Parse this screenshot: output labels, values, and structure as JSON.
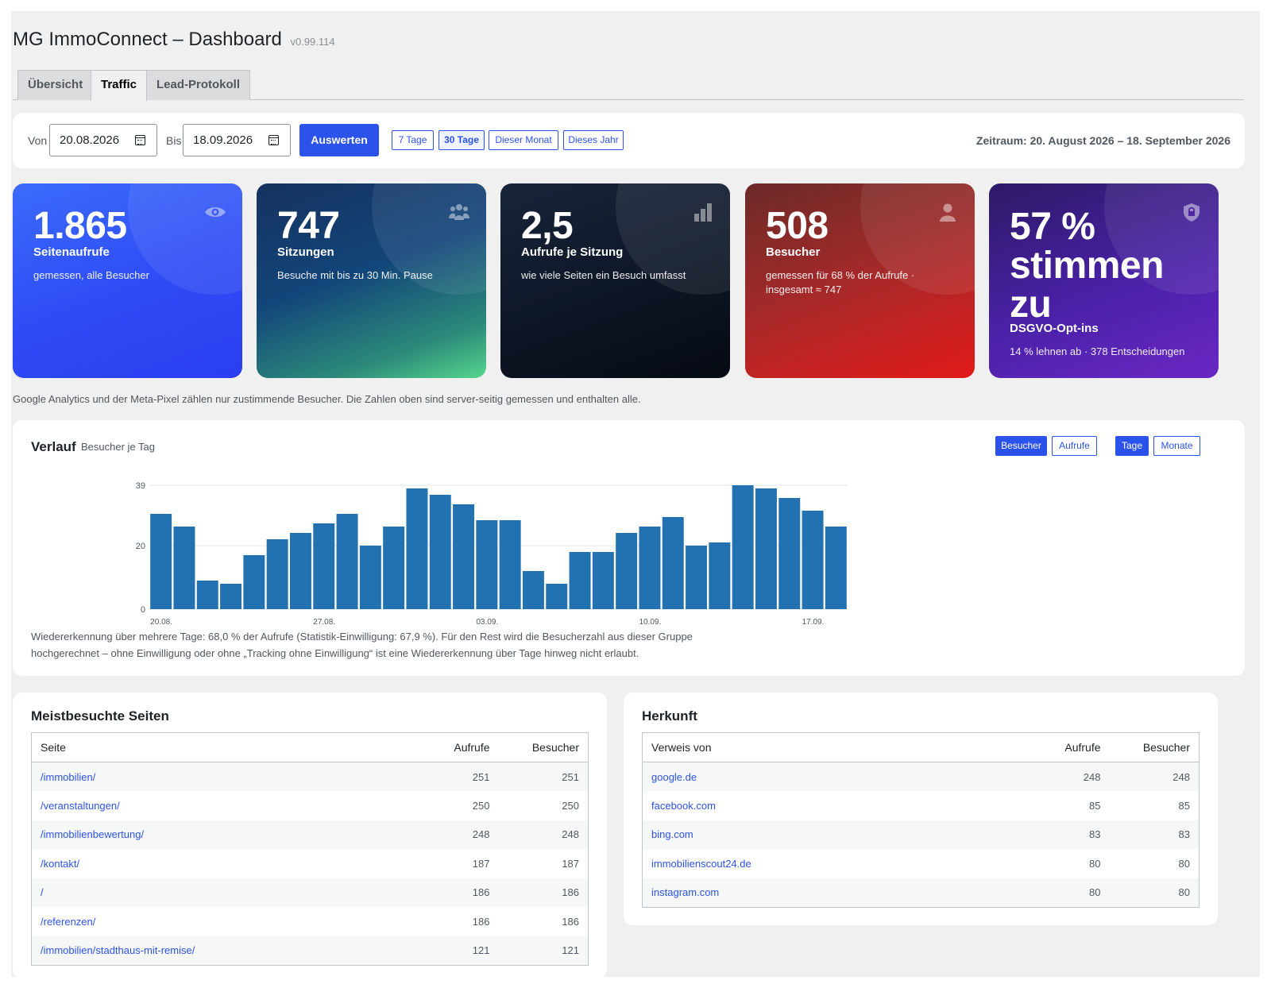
{
  "page": {
    "title": "MG ImmoConnect – Dashboard",
    "version": "v0.99.114"
  },
  "tabs": [
    {
      "label": "Übersicht"
    },
    {
      "label": "Traffic"
    },
    {
      "label": "Lead-Protokoll"
    }
  ],
  "filter": {
    "from_label": "Von",
    "from_value": "20.08.2026",
    "to_label": "Bis",
    "to_value": "18.09.2026",
    "submit_label": "Auswerten",
    "quick": [
      "7 Tage",
      "30 Tage",
      "Dieser Monat",
      "Dieses Jahr"
    ],
    "range_text": "Zeitraum: 20. August 2026 – 18. September 2026"
  },
  "kpis": [
    {
      "value": "1.865",
      "label": "Seitenaufrufe",
      "desc": "gemessen, alle Besucher",
      "icon": "eye-icon",
      "color": "#2e4bf5"
    },
    {
      "value": "747",
      "label": "Sitzungen",
      "desc": "Besuche mit bis zu 30 Min. Pause",
      "icon": "users-icon",
      "color": "#12457a"
    },
    {
      "value": "2,5",
      "label": "Aufrufe je Sitzung",
      "desc": "wie viele Seiten ein Besuch umfasst",
      "icon": "bar-chart-icon",
      "color": "#0d1524"
    },
    {
      "value": "508",
      "label": "Besucher",
      "desc": "gemessen für 68 % der Aufrufe · insgesamt ≈ 747",
      "icon": "user-icon",
      "color": "#a72929"
    },
    {
      "value": "57 % stimmen zu",
      "label": "DSGVO-Opt-ins",
      "desc": "14 % lehnen ab · 378 Entscheidungen",
      "icon": "shield-lock-icon",
      "color": "#4a21a8"
    }
  ],
  "note": "Google Analytics und der Meta-Pixel zählen nur zustimmende Besucher. Die Zahlen oben sind server-seitig gemessen und enthalten alle.",
  "chart": {
    "title": "Verlauf",
    "subtitle": "Besucher je Tag",
    "metric_toggle": [
      "Besucher",
      "Aufrufe"
    ],
    "period_toggle": [
      "Tage",
      "Monate"
    ],
    "wiedererkennung": "Wiedererkennung über mehrere Tage: 68,0 % der Aufrufe (Statistik-Einwilligung: 67,9 %). Für den Rest wird die Besucherzahl aus dieser Gruppe hochgerechnet – ohne Einwilligung oder ohne „Tracking ohne Einwilligung“ ist eine Wiedererkennung über Tage hinweg nicht erlaubt."
  },
  "chart_data": {
    "type": "bar",
    "categories": [
      "20.08.",
      "21.08.",
      "22.08.",
      "23.08.",
      "24.08.",
      "25.08.",
      "26.08.",
      "27.08.",
      "28.08.",
      "29.08.",
      "30.08.",
      "31.08.",
      "01.09.",
      "02.09.",
      "03.09.",
      "04.09.",
      "05.09.",
      "06.09.",
      "07.09.",
      "08.09.",
      "09.09.",
      "10.09.",
      "11.09.",
      "12.09.",
      "13.09.",
      "14.09.",
      "15.09.",
      "16.09.",
      "17.09.",
      "18.09."
    ],
    "x_tick_labels": [
      "20.08.",
      "27.08.",
      "03.09.",
      "10.09.",
      "17.09."
    ],
    "values": [
      30,
      26,
      9,
      8,
      17,
      22,
      24,
      27,
      30,
      20,
      26,
      38,
      36,
      33,
      28,
      28,
      12,
      8,
      18,
      18,
      24,
      26,
      29,
      20,
      21,
      39,
      38,
      35,
      31,
      26
    ],
    "yticks": [
      0,
      20,
      39
    ],
    "ylim": [
      0,
      39
    ],
    "color": "#2271b1",
    "grid": true
  },
  "top_pages": {
    "title": "Meistbesuchte Seiten",
    "headers": [
      "Seite",
      "Aufrufe",
      "Besucher"
    ],
    "rows": [
      [
        "/immobilien/",
        "251",
        "251"
      ],
      [
        "/veranstaltungen/",
        "250",
        "250"
      ],
      [
        "/immobilienbewertung/",
        "248",
        "248"
      ],
      [
        "/kontakt/",
        "187",
        "187"
      ],
      [
        "/",
        "186",
        "186"
      ],
      [
        "/referenzen/",
        "186",
        "186"
      ],
      [
        "/immobilien/stadthaus-mit-remise/",
        "121",
        "121"
      ]
    ]
  },
  "referrers": {
    "title": "Herkunft",
    "headers": [
      "Verweis von",
      "Aufrufe",
      "Besucher"
    ],
    "rows": [
      [
        "google.de",
        "248",
        "248"
      ],
      [
        "facebook.com",
        "85",
        "85"
      ],
      [
        "bing.com",
        "83",
        "83"
      ],
      [
        "immobilienscout24.de",
        "80",
        "80"
      ],
      [
        "instagram.com",
        "80",
        "80"
      ]
    ]
  }
}
